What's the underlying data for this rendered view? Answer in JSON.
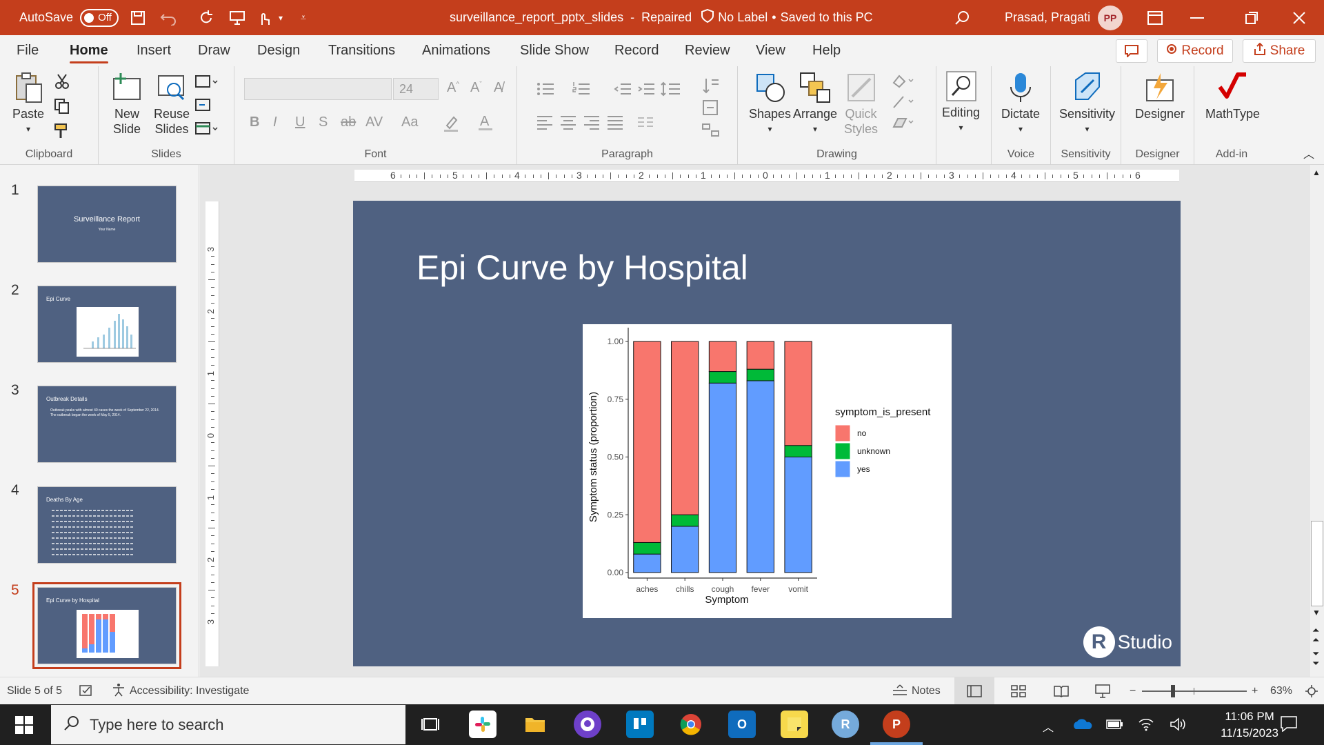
{
  "titlebar": {
    "autosave_label": "AutoSave",
    "autosave_state": "Off",
    "filename": "surveillance_report_pptx_slides",
    "separator": "-",
    "repaired": "Repaired",
    "label_status": "No Label",
    "bullet": "•",
    "saved_status": "Saved to this PC",
    "user_name": "Prasad, Pragati",
    "user_initials": "PP"
  },
  "menu": {
    "tabs": [
      "File",
      "Home",
      "Insert",
      "Draw",
      "Design",
      "Transitions",
      "Animations",
      "Slide Show",
      "Record",
      "Review",
      "View",
      "Help"
    ],
    "record_button": "Record",
    "share_button": "Share"
  },
  "ribbon": {
    "clipboard": {
      "label": "Clipboard",
      "paste": "Paste"
    },
    "slides": {
      "label": "Slides",
      "new_slide": [
        "New",
        "Slide"
      ],
      "reuse_slides": [
        "Reuse",
        "Slides"
      ]
    },
    "font": {
      "label": "Font",
      "size": "24"
    },
    "paragraph": {
      "label": "Paragraph"
    },
    "drawing": {
      "label": "Drawing",
      "shapes": "Shapes",
      "arrange": "Arrange",
      "quick_styles": [
        "Quick",
        "Styles"
      ]
    },
    "editing": {
      "label": "Editing"
    },
    "voice": {
      "label": "Voice",
      "dictate": "Dictate"
    },
    "sensitivity": {
      "label": "Sensitivity",
      "button": "Sensitivity"
    },
    "designer": {
      "label": "Designer",
      "button": "Designer"
    },
    "addin": {
      "label": "Add-in",
      "mathtype": "MathType"
    }
  },
  "ruler": {
    "h_labels": [
      "6",
      "5",
      "4",
      "3",
      "2",
      "1",
      "0",
      "1",
      "2",
      "3",
      "4",
      "5",
      "6"
    ],
    "v_labels": [
      "3",
      "2",
      "1",
      "0",
      "1",
      "2",
      "3"
    ]
  },
  "thumbnails": [
    {
      "num": "1",
      "title": "Surveillance Report",
      "subtitle": "Your Name"
    },
    {
      "num": "2",
      "title": "Epi Curve"
    },
    {
      "num": "3",
      "title": "Outbreak Details",
      "bullets": [
        "Outbreak peaks with almost 40 cases the week of September 22, 2014.",
        "The outbreak began the week of May 5, 2014."
      ]
    },
    {
      "num": "4",
      "title": "Deaths By Age"
    },
    {
      "num": "5",
      "title": "Epi Curve by Hospital"
    }
  ],
  "slide": {
    "title": "Epi Curve by Hospital",
    "logo_text": "Studio",
    "logo_letter": "R"
  },
  "chart_data": {
    "type": "bar",
    "stacked": true,
    "categories": [
      "aches",
      "chills",
      "cough",
      "fever",
      "vomit"
    ],
    "series": [
      {
        "name": "yes",
        "color": "#619cff",
        "values": [
          0.08,
          0.2,
          0.82,
          0.83,
          0.5
        ]
      },
      {
        "name": "unknown",
        "color": "#00ba38",
        "values": [
          0.05,
          0.05,
          0.05,
          0.05,
          0.05
        ]
      },
      {
        "name": "no",
        "color": "#f8766d",
        "values": [
          0.87,
          0.75,
          0.13,
          0.12,
          0.45
        ]
      }
    ],
    "legend_title": "symptom_is_present",
    "legend_entries": [
      "no",
      "unknown",
      "yes"
    ],
    "legend_position": "right",
    "xlabel": "Symptom",
    "ylabel": "Symptom status (proportion)",
    "yticks": [
      "0.00",
      "0.25",
      "0.50",
      "0.75",
      "1.00"
    ],
    "ylim": [
      0,
      1
    ]
  },
  "status": {
    "slide_of": "Slide 5 of 5",
    "accessibility": "Accessibility: Investigate",
    "notes": "Notes",
    "zoom": "63%"
  },
  "taskbar": {
    "search_placeholder": "Type here to search",
    "time": "11:06 PM",
    "date": "11/15/2023"
  }
}
